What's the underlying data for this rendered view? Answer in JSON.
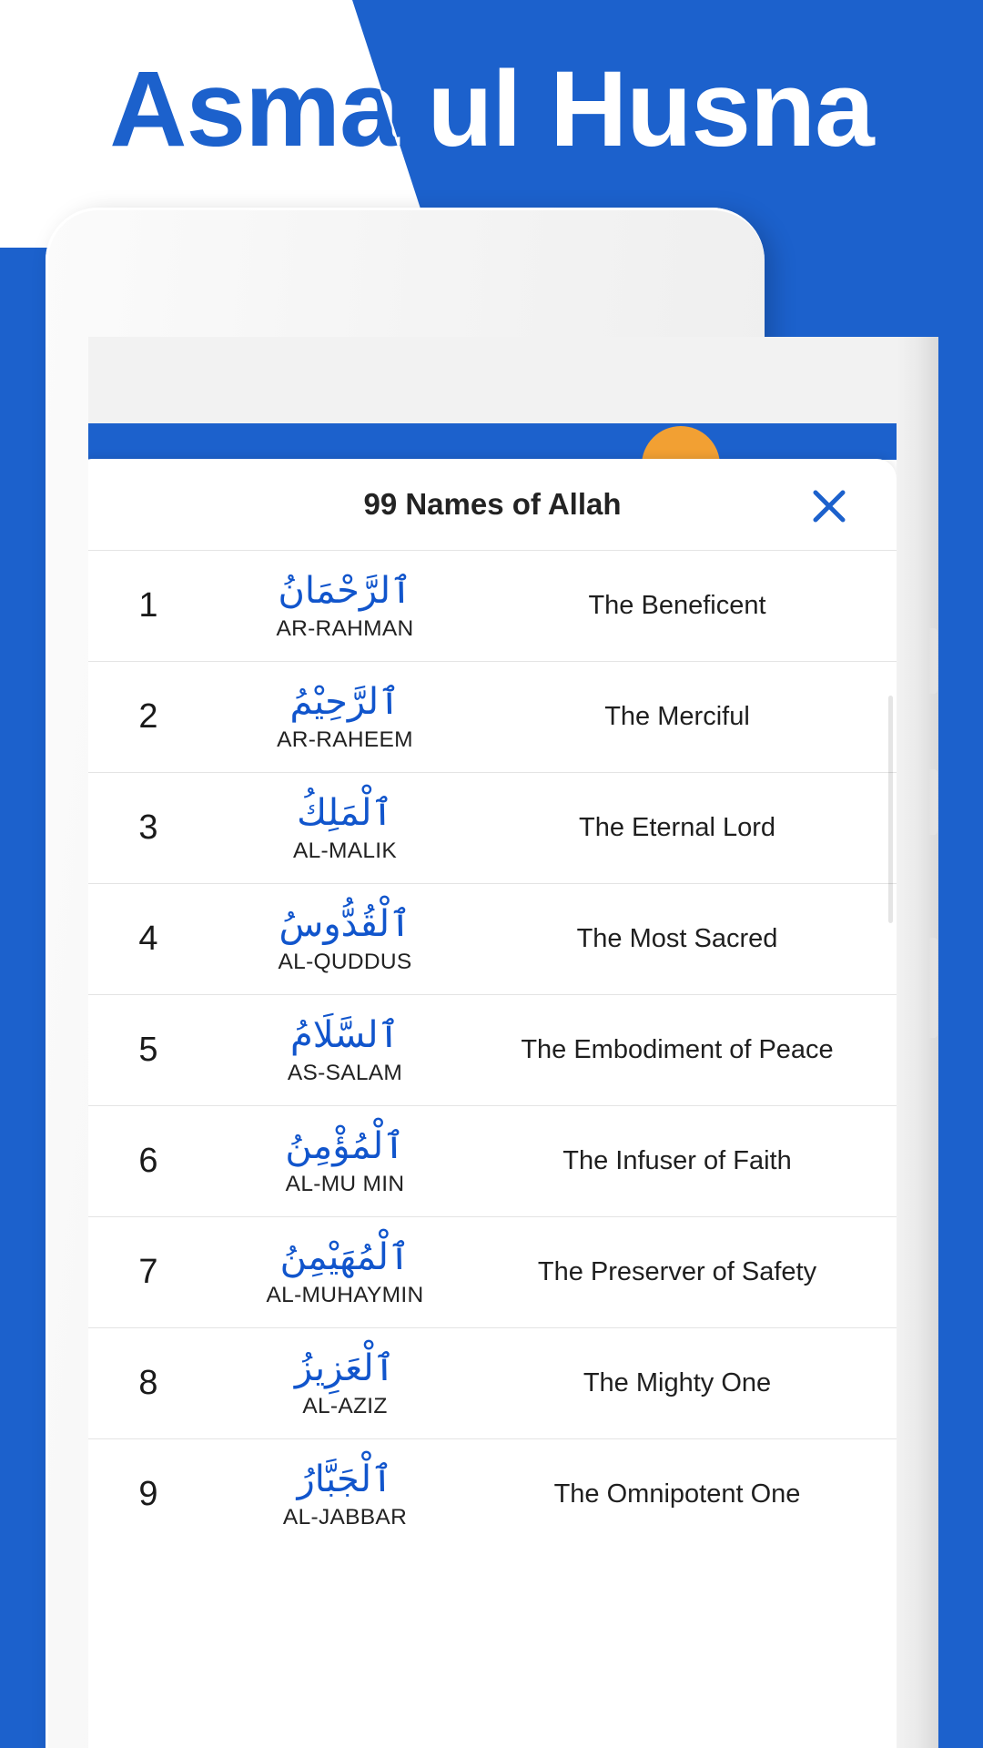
{
  "poster": {
    "headline": "Asma ul Husna",
    "background_color_blue": "#1c61cc",
    "background_color_white": "#ffffff",
    "headline_blue_color": "#1c61cc",
    "headline_white_color": "#ffffff"
  },
  "app": {
    "accent_color": "#1c61cc",
    "fab_color": "#f2a033",
    "arabic_color": "#1155cc"
  },
  "dialog": {
    "title": "99 Names of Allah",
    "close_icon": "close-icon"
  },
  "names": [
    {
      "index": "1",
      "arabic": "ٱلرَّحْمَانُ",
      "translit": "AR-RAHMAN",
      "meaning": "The Beneficent"
    },
    {
      "index": "2",
      "arabic": "ٱلرَّحِيْمُ",
      "translit": "AR-RAHEEM",
      "meaning": "The Merciful"
    },
    {
      "index": "3",
      "arabic": "ٱلْمَلِكُ",
      "translit": "AL-MALIK",
      "meaning": "The Eternal Lord"
    },
    {
      "index": "4",
      "arabic": "ٱلْقُدُّوسُ",
      "translit": "AL-QUDDUS",
      "meaning": "The Most Sacred"
    },
    {
      "index": "5",
      "arabic": "ٱلسَّلَامُ",
      "translit": "AS-SALAM",
      "meaning": "The Embodiment of Peace"
    },
    {
      "index": "6",
      "arabic": "ٱلْمُؤْمِنُ",
      "translit": "AL-MU MIN",
      "meaning": "The Infuser of Faith"
    },
    {
      "index": "7",
      "arabic": "ٱلْمُهَيْمِنُ",
      "translit": "AL-MUHAYMIN",
      "meaning": "The Preserver of Safety"
    },
    {
      "index": "8",
      "arabic": "ٱلْعَزِيزُ",
      "translit": "AL-AZIZ",
      "meaning": "The Mighty One"
    },
    {
      "index": "9",
      "arabic": "ٱلْجَبَّارُ",
      "translit": "AL-JABBAR",
      "meaning": "The Omnipotent One"
    }
  ]
}
